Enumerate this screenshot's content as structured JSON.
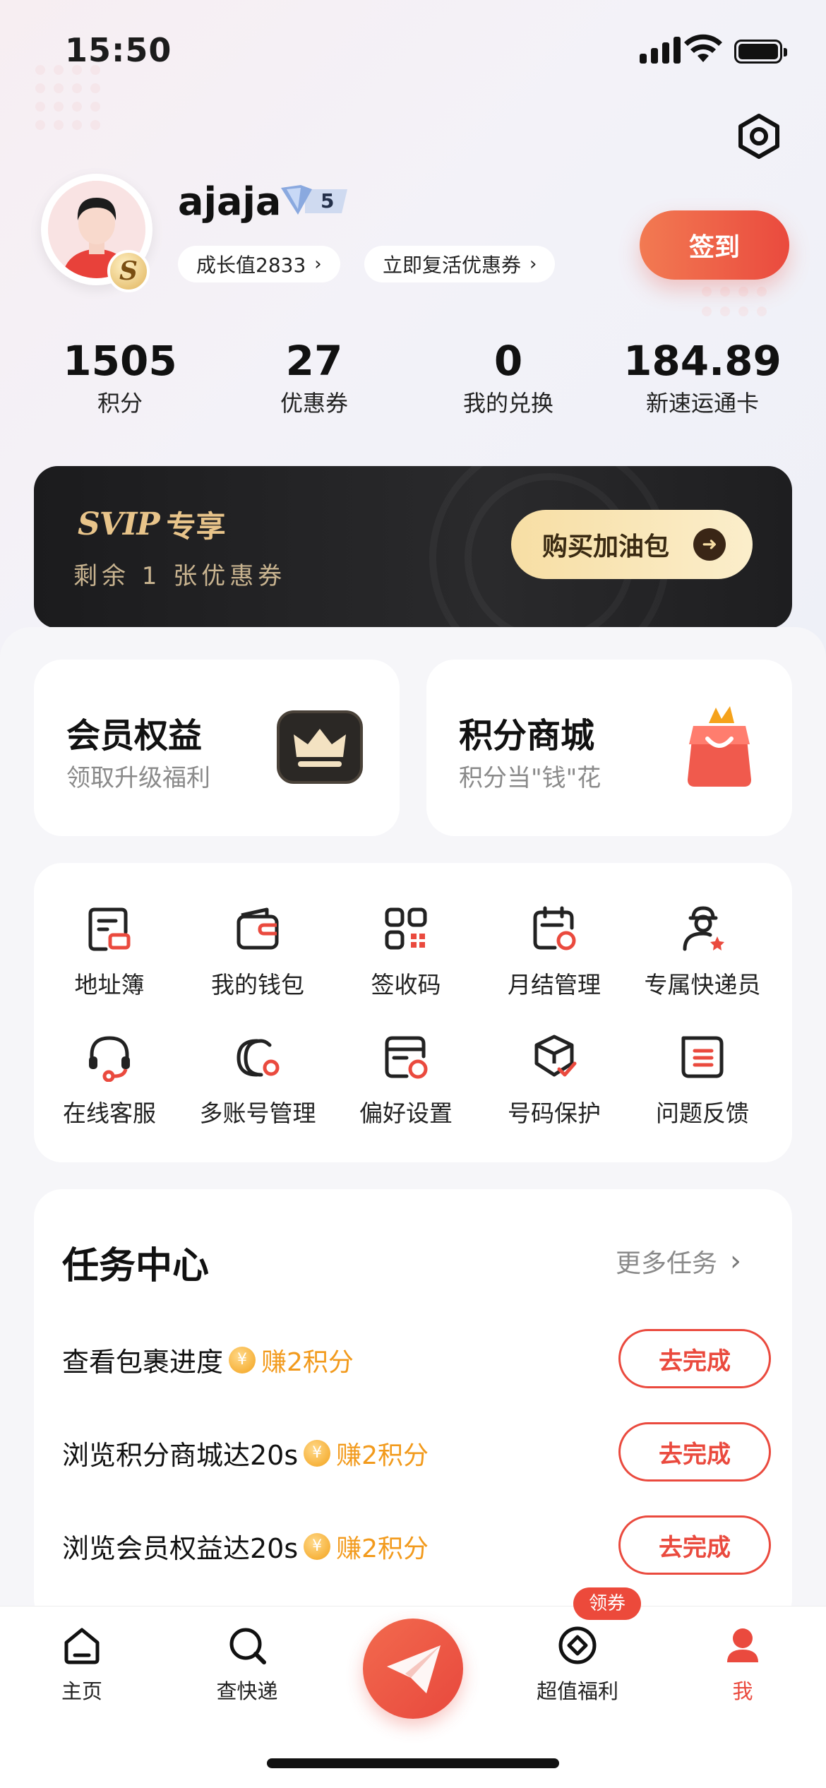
{
  "status_bar": {
    "time": "15:50"
  },
  "profile": {
    "username": "ajaja",
    "vip_level": "5",
    "avatar_badge": "S",
    "growth_label": "成长值2833",
    "revive_label": "立即复活优惠券",
    "signin_label": "签到"
  },
  "stats": [
    {
      "value": "1505",
      "label": "积分"
    },
    {
      "value": "27",
      "label": "优惠券"
    },
    {
      "value": "0",
      "label": "我的兑换"
    },
    {
      "value": "184.89",
      "label": "新速运通卡"
    }
  ],
  "svip": {
    "logo": "SVIP",
    "title": "专享",
    "subtitle": "剩余 1 张优惠券",
    "button_label": "购买加油包"
  },
  "promo": [
    {
      "title": "会员权益",
      "subtitle": "领取升级福利",
      "icon": "crown-icon"
    },
    {
      "title": "积分商城",
      "subtitle": "积分当\"钱\"花",
      "icon": "shopping-bag-icon"
    }
  ],
  "services": [
    {
      "label": "地址簿",
      "icon": "address-book-icon"
    },
    {
      "label": "我的钱包",
      "icon": "wallet-icon"
    },
    {
      "label": "签收码",
      "icon": "qr-code-icon"
    },
    {
      "label": "月结管理",
      "icon": "calendar-settings-icon"
    },
    {
      "label": "专属快递员",
      "icon": "courier-icon"
    },
    {
      "label": "在线客服",
      "icon": "headset-icon"
    },
    {
      "label": "多账号管理",
      "icon": "multi-account-icon"
    },
    {
      "label": "偏好设置",
      "icon": "preferences-icon"
    },
    {
      "label": "号码保护",
      "icon": "shield-box-icon"
    },
    {
      "label": "问题反馈",
      "icon": "feedback-icon"
    }
  ],
  "tasks": {
    "title": "任务中心",
    "more_label": "更多任务",
    "items": [
      {
        "name": "查看包裹进度",
        "reward": "赚2积分",
        "button": "去完成"
      },
      {
        "name": "浏览积分商城达20s",
        "reward": "赚2积分",
        "button": "去完成"
      },
      {
        "name": "浏览会员权益达20s",
        "reward": "赚2积分",
        "button": "去完成"
      }
    ]
  },
  "tabbar": {
    "items": [
      {
        "label": "主页",
        "icon": "home-icon"
      },
      {
        "label": "查快递",
        "icon": "search-icon"
      },
      {
        "label": "",
        "icon": "send-plane-icon"
      },
      {
        "label": "超值福利",
        "icon": "target-icon",
        "badge": "领券"
      },
      {
        "label": "我",
        "icon": "user-icon",
        "active": true
      }
    ]
  },
  "colors": {
    "accent": "#ea4a3e",
    "gold": "#e8c48a",
    "reward": "#f29a1c"
  }
}
